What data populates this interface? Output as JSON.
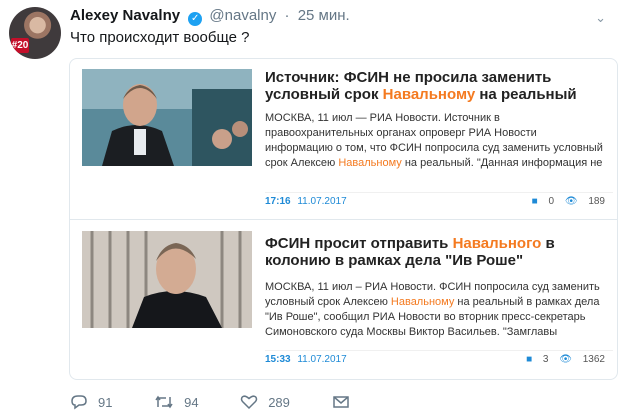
{
  "tweet": {
    "author_name": "Alexey Navalny",
    "handle": "@navalny",
    "separator": "·",
    "time": "25 мин.",
    "text": "Что происходит вообще ?",
    "avatar_badge": "#20"
  },
  "articles": [
    {
      "headline_a": "Источник: ФСИН не просила заменить условный срок ",
      "headline_name": "Навальному",
      "headline_b": " на реальный",
      "body_a": "МОСКВА, 11 июл — РИА Новости. Источник в правоохранительных органах опроверг РИА Новости информацию о том, что ФСИН попросила суд заменить условный срок Алексею ",
      "body_name": "Навальному",
      "body_b": " на реальный. \"Данная информация не",
      "time": "17:16",
      "date": "11.07.2017",
      "comments": "0",
      "views": "189"
    },
    {
      "headline_a": "ФСИН просит отправить ",
      "headline_name": "Навального",
      "headline_b": " в колонию в рамках дела \"Ив Роше\"",
      "body_a": "МОСКВА, 11 июл – РИА Новости. ФСИН попросила суд заменить условный срок Алексею ",
      "body_name": "Навальному",
      "body_b": " на реальный в рамках дела \"Ив Роше\", сообщил РИА Новости во вторник пресс-секретарь Симоновского суда Москвы Виктор Васильев. \"Замглавы",
      "time": "15:33",
      "date": "11.07.2017",
      "comments": "3",
      "views": "1362"
    }
  ],
  "actions": {
    "replies": "91",
    "retweets": "94",
    "likes": "289"
  },
  "colors": {
    "highlight": "#f47a20",
    "link_blue": "#1e8ad6",
    "twitter_blue": "#1da1f2"
  }
}
